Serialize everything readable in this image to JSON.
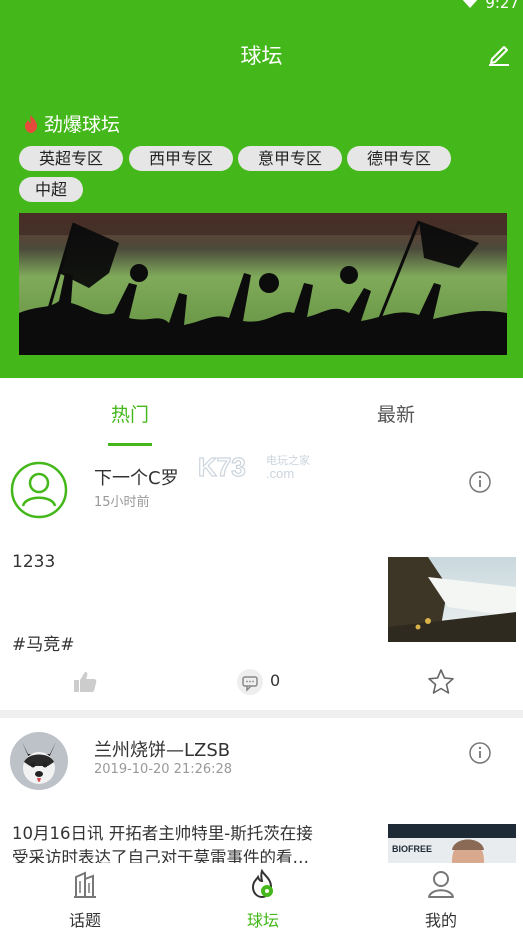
{
  "status": {
    "time": "9:27"
  },
  "header": {
    "title": "球坛",
    "hot_label": "劲爆球坛"
  },
  "chips": [
    "英超专区",
    "西甲专区",
    "意甲专区",
    "德甲专区",
    "中超"
  ],
  "tabs": {
    "hot": "热门",
    "latest": "最新"
  },
  "watermark": {
    "main": "K73",
    "sub": "电玩之家",
    "domain": ".com"
  },
  "posts": [
    {
      "author": "下一个C罗",
      "time": "15小时前",
      "text": "1233",
      "tag": "#马竞#",
      "comments": "0"
    },
    {
      "author": "兰州烧饼—LZSB",
      "time": "2019-10-20 21:26:28",
      "text_line1": "10月16日讯 开拓者主帅特里-斯托茨在接",
      "text_line2": "受采访时表达了自己对于莫雷事件的看…",
      "thumb_text": "BIOFREE"
    }
  ],
  "nav": {
    "topics": "话题",
    "forum": "球坛",
    "mine": "我的"
  },
  "colors": {
    "primary": "#44b81a",
    "chip_bg": "#e6e6e6"
  }
}
